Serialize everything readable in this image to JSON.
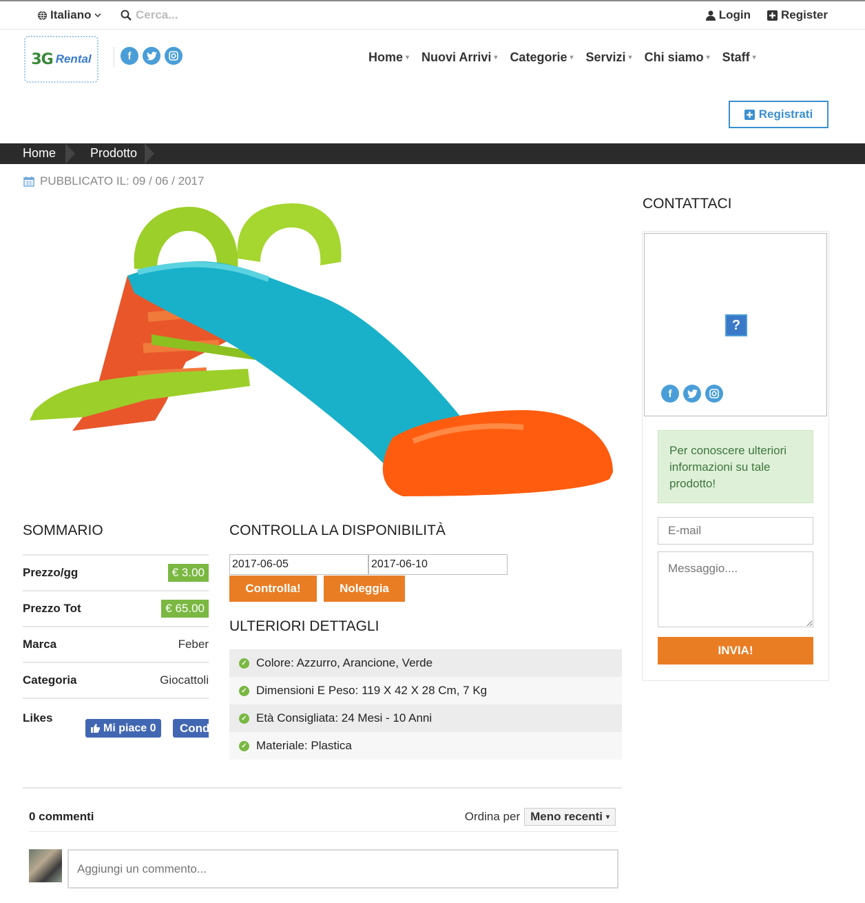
{
  "topbar": {
    "language": "Italiano",
    "search_placeholder": "Cerca...",
    "login": "Login",
    "register": "Register"
  },
  "header": {
    "logo_main": "3G",
    "logo_sub": "Rental",
    "nav": [
      "Home",
      "Nuovi Arrivi",
      "Categorie",
      "Servizi",
      "Chi siamo",
      "Staff"
    ],
    "registrati": "Registrati",
    "social_icons": [
      "facebook-icon",
      "twitter-icon",
      "instagram-icon"
    ]
  },
  "breadcrumb": [
    "Home",
    "Prodotto"
  ],
  "published": "PUBBLICATO IL: 09 / 06 / 2017",
  "summary": {
    "title": "SOMMARIO",
    "rows": [
      {
        "label": "Prezzo/gg",
        "value": "€ 3.00",
        "badge": true
      },
      {
        "label": "Prezzo Tot",
        "value": "€ 65.00",
        "badge": true
      },
      {
        "label": "Marca",
        "value": "Feber",
        "badge": false
      },
      {
        "label": "Categoria",
        "value": "Giocattoli",
        "badge": false
      }
    ],
    "likes_label": "Likes",
    "like_button": "Mi piace 0",
    "share_button": "Condividi"
  },
  "availability": {
    "title": "CONTROLLA LA DISPONIBILITÀ",
    "date_from": "2017-06-05",
    "date_to": "2017-06-10",
    "check_button": "Controlla!",
    "rent_button": "Noleggia"
  },
  "details": {
    "title": "ULTERIORI DETTAGLI",
    "items": [
      "Colore: Azzurro, Arancione, Verde",
      "Dimensioni E Peso: 119 X 42 X 28 Cm, 7 Kg",
      "Età Consigliata: 24 Mesi - 10 Anni",
      "Materiale: Plastica"
    ]
  },
  "comments": {
    "count": "0 commenti",
    "sort_label": "Ordina per",
    "sort_value": "Meno recenti",
    "placeholder": "Aggiungi un commento..."
  },
  "sidebar": {
    "title": "CONTATTACI",
    "alert": "Per conoscere ulteriori informazioni su tale prodotto!",
    "email_placeholder": "E-mail",
    "message_placeholder": "Messaggio....",
    "send_button": "INVIA!"
  },
  "colors": {
    "accent_orange": "#e97d24",
    "badge_green": "#7ab842",
    "link_blue": "#3a8fd0",
    "breadcrumb_bg": "#2b2b2b"
  }
}
